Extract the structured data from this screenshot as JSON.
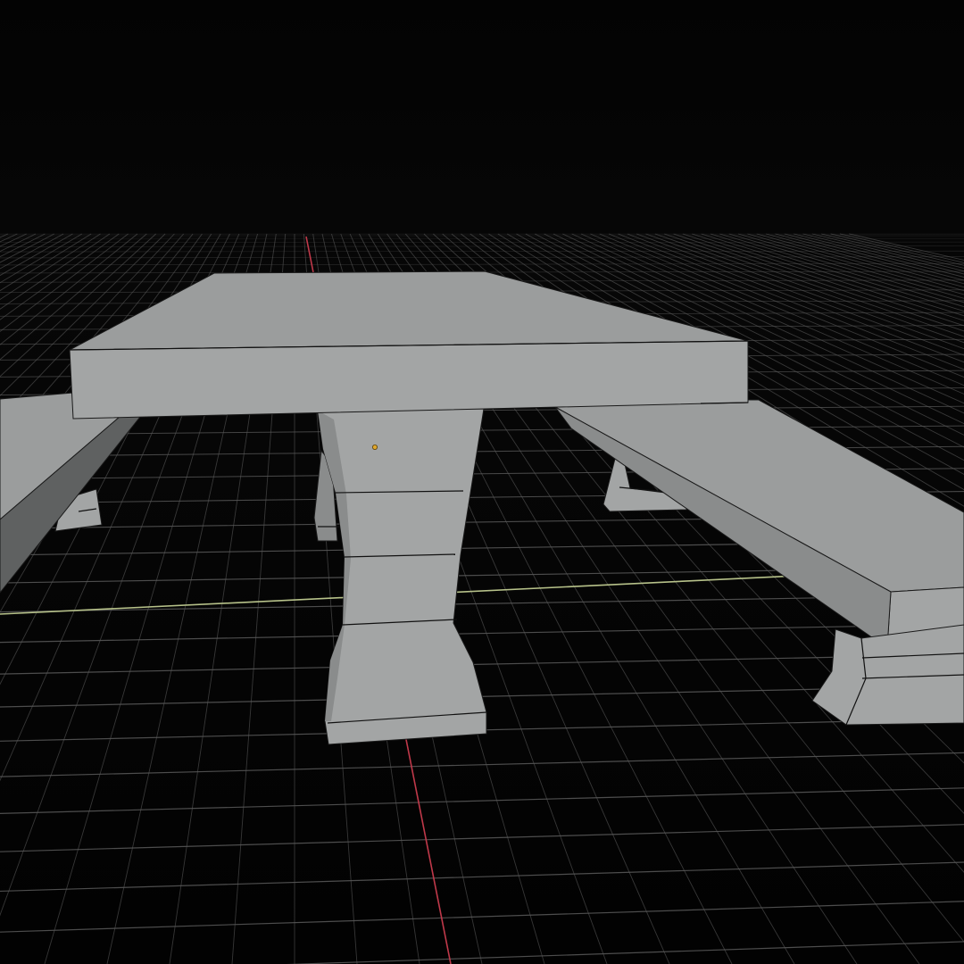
{
  "viewport": {
    "name": "3D Viewport",
    "background_color": "#020202",
    "grid_color": "#5a5a5a",
    "x_axis_color": "#b7c28a",
    "y_axis_color": "#c0394a",
    "mesh_color": "#a3a5a5",
    "origin_color": "#e0a82e"
  },
  "scene": {
    "objects": [
      "table",
      "bench-left",
      "bench-right"
    ]
  }
}
